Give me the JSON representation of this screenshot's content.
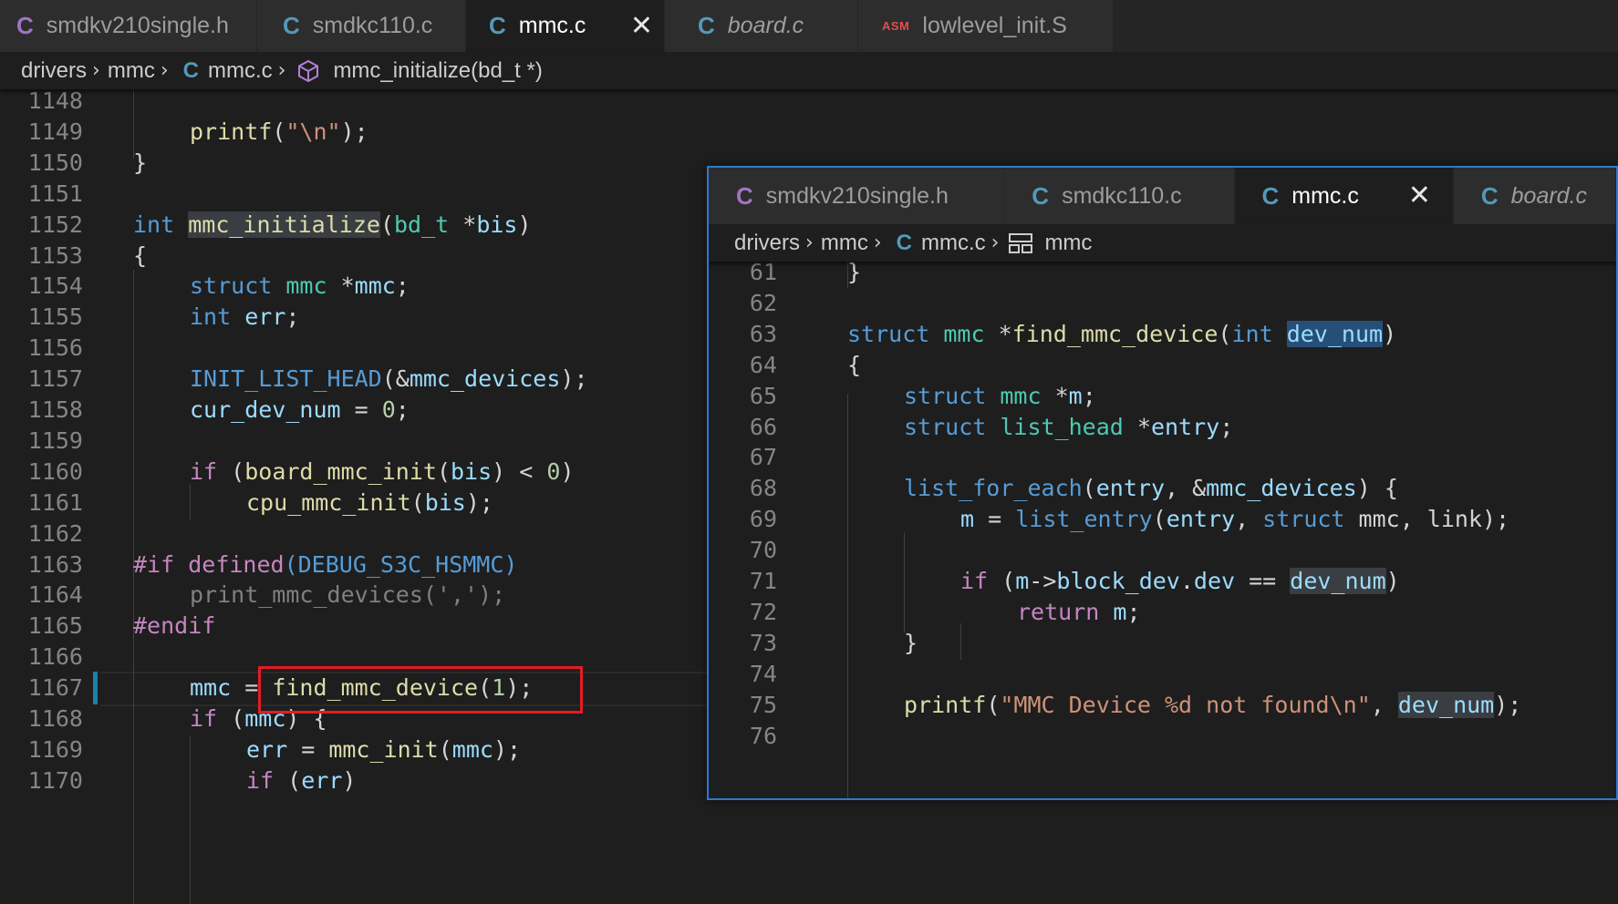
{
  "main": {
    "tabs": [
      {
        "label": "smdkv210single.h",
        "icon": "C",
        "kind": "header"
      },
      {
        "label": "smdkc110.c",
        "icon": "C",
        "kind": "source"
      },
      {
        "label": "mmc.c",
        "icon": "C",
        "kind": "source",
        "active": true,
        "close": "✕"
      },
      {
        "label": "board.c",
        "icon": "C",
        "kind": "source",
        "italic": true
      },
      {
        "label": "lowlevel_init.S",
        "icon": "ASM",
        "kind": "asm"
      }
    ],
    "breadcrumb": {
      "folder1": "drivers",
      "folder2": "mmc",
      "file_icon": "C",
      "file": "mmc.c",
      "symbol": "mmc_initialize(bd_t *)"
    },
    "lines": [
      {
        "n": "1148",
        "tokens": []
      },
      {
        "n": "1149",
        "tokens": [
          [
            "fn",
            "printf"
          ],
          [
            "pl",
            "("
          ],
          [
            "st",
            "\"\\n\""
          ],
          [
            "pl",
            ");"
          ]
        ]
      },
      {
        "n": "1150",
        "tokens": [
          [
            "pl",
            "}"
          ]
        ]
      },
      {
        "n": "1151",
        "tokens": []
      },
      {
        "n": "1152",
        "tokens": [
          [
            "kw",
            "int"
          ],
          [
            "pl",
            " "
          ],
          [
            "fn hl-word",
            "mmc_initialize"
          ],
          [
            "pl",
            "("
          ],
          [
            "ty",
            "bd_t"
          ],
          [
            "pl",
            " *"
          ],
          [
            "vr",
            "bis"
          ],
          [
            "pl",
            ")"
          ]
        ]
      },
      {
        "n": "1153",
        "tokens": [
          [
            "pl",
            "{"
          ]
        ]
      },
      {
        "n": "1154",
        "tokens": [
          [
            "kw",
            "struct"
          ],
          [
            "pl",
            " "
          ],
          [
            "ty",
            "mmc"
          ],
          [
            "pl",
            " *"
          ],
          [
            "vr",
            "mmc"
          ],
          [
            "pl",
            ";"
          ]
        ]
      },
      {
        "n": "1155",
        "tokens": [
          [
            "kw",
            "int"
          ],
          [
            "pl",
            " "
          ],
          [
            "vr",
            "err"
          ],
          [
            "pl",
            ";"
          ]
        ]
      },
      {
        "n": "1156",
        "tokens": []
      },
      {
        "n": "1157",
        "tokens": [
          [
            "mc",
            "INIT_LIST_HEAD"
          ],
          [
            "pl",
            "(&"
          ],
          [
            "vr",
            "mmc_devices"
          ],
          [
            "pl",
            ");"
          ]
        ]
      },
      {
        "n": "1158",
        "tokens": [
          [
            "vr",
            "cur_dev_num"
          ],
          [
            "pl",
            " = "
          ],
          [
            "nm",
            "0"
          ],
          [
            "pl",
            ";"
          ]
        ]
      },
      {
        "n": "1159",
        "tokens": []
      },
      {
        "n": "1160",
        "tokens": [
          [
            "pp",
            "if"
          ],
          [
            "pl",
            " ("
          ],
          [
            "fn",
            "board_mmc_init"
          ],
          [
            "pl",
            "("
          ],
          [
            "vr",
            "bis"
          ],
          [
            "pl",
            ") < "
          ],
          [
            "nm",
            "0"
          ],
          [
            "pl",
            ")"
          ]
        ]
      },
      {
        "n": "1161",
        "tokens": [
          [
            "fn",
            "cpu_mmc_init"
          ],
          [
            "pl",
            "("
          ],
          [
            "vr",
            "bis"
          ],
          [
            "pl",
            ");"
          ]
        ]
      },
      {
        "n": "1162",
        "tokens": []
      },
      {
        "n": "1163",
        "tokens": [
          [
            "pp",
            "#if"
          ],
          [
            "pl",
            " "
          ],
          [
            "pp",
            "defined"
          ],
          [
            "mc",
            "(DEBUG_S3C_HSMMC)"
          ]
        ]
      },
      {
        "n": "1164",
        "tokens": [
          [
            "gr",
            "print_mmc_devices(',');"
          ]
        ]
      },
      {
        "n": "1165",
        "tokens": [
          [
            "pp",
            "#endif"
          ]
        ]
      },
      {
        "n": "1166",
        "tokens": []
      },
      {
        "n": "1167",
        "tokens": [
          [
            "vr",
            "mmc"
          ],
          [
            "pl",
            " = "
          ],
          [
            "fn",
            "find_mmc_device"
          ],
          [
            "pl",
            "("
          ],
          [
            "nm",
            "1"
          ],
          [
            "pl",
            ");"
          ]
        ]
      },
      {
        "n": "1168",
        "tokens": [
          [
            "pp",
            "if"
          ],
          [
            "pl",
            " ("
          ],
          [
            "vr",
            "mmc"
          ],
          [
            "pl",
            ") {"
          ]
        ]
      },
      {
        "n": "1169",
        "tokens": [
          [
            "vr",
            "err"
          ],
          [
            "pl",
            " = "
          ],
          [
            "fn",
            "mmc_init"
          ],
          [
            "pl",
            "("
          ],
          [
            "vr",
            "mmc"
          ],
          [
            "pl",
            ");"
          ]
        ]
      },
      {
        "n": "1170",
        "tokens": [
          [
            "pp",
            "if"
          ],
          [
            "pl",
            " ("
          ],
          [
            "vr",
            "err"
          ],
          [
            "pl",
            ")"
          ]
        ]
      }
    ]
  },
  "peek": {
    "tabs": [
      {
        "label": "smdkv210single.h",
        "icon": "C",
        "kind": "header"
      },
      {
        "label": "smdkc110.c",
        "icon": "C",
        "kind": "source"
      },
      {
        "label": "mmc.c",
        "icon": "C",
        "kind": "source",
        "active": true,
        "close": "✕"
      },
      {
        "label": "board.c",
        "icon": "C",
        "kind": "source",
        "italic": true
      }
    ],
    "breadcrumb": {
      "folder1": "drivers",
      "folder2": "mmc",
      "file_icon": "C",
      "file": "mmc.c",
      "symbol": "mmc"
    },
    "lines": [
      {
        "n": "61",
        "tokens": [
          [
            "pl",
            "}"
          ]
        ]
      },
      {
        "n": "62",
        "tokens": []
      },
      {
        "n": "63",
        "tokens": [
          [
            "kw",
            "struct"
          ],
          [
            "pl",
            " "
          ],
          [
            "ty",
            "mmc"
          ],
          [
            "pl",
            " *"
          ],
          [
            "fn",
            "find_mmc_device"
          ],
          [
            "pl",
            "("
          ],
          [
            "kw",
            "int"
          ],
          [
            "pl",
            " "
          ],
          [
            "vr hl-sel",
            "dev_num"
          ],
          [
            "pl",
            ")"
          ]
        ]
      },
      {
        "n": "64",
        "tokens": [
          [
            "pl",
            "{"
          ]
        ]
      },
      {
        "n": "65",
        "tokens": [
          [
            "kw",
            "struct"
          ],
          [
            "pl",
            " "
          ],
          [
            "ty",
            "mmc"
          ],
          [
            "pl",
            " *"
          ],
          [
            "vr",
            "m"
          ],
          [
            "pl",
            ";"
          ]
        ]
      },
      {
        "n": "66",
        "tokens": [
          [
            "kw",
            "struct"
          ],
          [
            "pl",
            " "
          ],
          [
            "ty",
            "list_head"
          ],
          [
            "pl",
            " *"
          ],
          [
            "vr",
            "entry"
          ],
          [
            "pl",
            ";"
          ]
        ]
      },
      {
        "n": "67",
        "tokens": []
      },
      {
        "n": "68",
        "tokens": [
          [
            "mc",
            "list_for_each"
          ],
          [
            "pl",
            "("
          ],
          [
            "vr",
            "entry"
          ],
          [
            "pl",
            ", &"
          ],
          [
            "vr",
            "mmc_devices"
          ],
          [
            "pl",
            ") {"
          ]
        ]
      },
      {
        "n": "69",
        "tokens": [
          [
            "vr",
            "m"
          ],
          [
            "pl",
            " = "
          ],
          [
            "mc",
            "list_entry"
          ],
          [
            "pl",
            "("
          ],
          [
            "vr",
            "entry"
          ],
          [
            "pl",
            ", "
          ],
          [
            "kw",
            "struct"
          ],
          [
            "pl",
            " mmc, link);"
          ]
        ]
      },
      {
        "n": "70",
        "tokens": []
      },
      {
        "n": "71",
        "tokens": [
          [
            "pp",
            "if"
          ],
          [
            "pl",
            " ("
          ],
          [
            "vr",
            "m"
          ],
          [
            "pl",
            "->"
          ],
          [
            "vr",
            "block_dev"
          ],
          [
            "pl",
            "."
          ],
          [
            "vr",
            "dev"
          ],
          [
            "pl",
            " == "
          ],
          [
            "vr hl-word",
            "dev_num"
          ],
          [
            "pl",
            ")"
          ]
        ]
      },
      {
        "n": "72",
        "tokens": [
          [
            "pp",
            "return"
          ],
          [
            "pl",
            " "
          ],
          [
            "vr",
            "m"
          ],
          [
            "pl",
            ";"
          ]
        ]
      },
      {
        "n": "73",
        "tokens": [
          [
            "pl",
            "}"
          ]
        ]
      },
      {
        "n": "74",
        "tokens": []
      },
      {
        "n": "75",
        "tokens": [
          [
            "fn",
            "printf"
          ],
          [
            "pl",
            "("
          ],
          [
            "st",
            "\"MMC Device %d not found\\n\""
          ],
          [
            "pl",
            ", "
          ],
          [
            "vr hl-word",
            "dev_num"
          ],
          [
            "pl",
            ");"
          ]
        ]
      },
      {
        "n": "76",
        "tokens": []
      }
    ]
  },
  "colors": {
    "background": "#1e1e1e",
    "tabbar": "#252526",
    "peek_border": "#2b79d1",
    "annotation_box": "#e51c23"
  }
}
